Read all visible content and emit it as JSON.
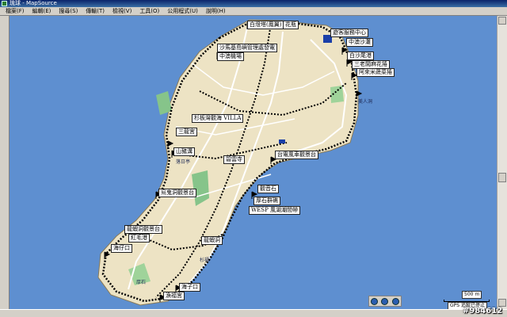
{
  "window": {
    "title": "琉球 - MapSource"
  },
  "menu": [
    {
      "label": "檔案(F)"
    },
    {
      "label": "編輯(E)"
    },
    {
      "label": "搜尋(S)"
    },
    {
      "label": "傳輸(T)"
    },
    {
      "label": "檢視(V)"
    },
    {
      "label": "工具(O)"
    },
    {
      "label": "公用程式(U)"
    },
    {
      "label": "說明(H)"
    }
  ],
  "map_labels": {
    "l1": "白燈塔(鳳翼)",
    "l2": "花瓶",
    "l3": "遊客服務中心",
    "l4": "中澳沙灘",
    "l5": "沙馬基島嶼管理處發電",
    "l6": "中澳機場",
    "l7": "白沙尾港",
    "l8": "三老闆麻花捲",
    "l9": "阿來米蔬菜捲",
    "l10": "美人洞",
    "l11": "杉板灣觀海 VILLA",
    "l12": "三龍宮",
    "l13": "山豬溝",
    "l14": "碧雲寺",
    "l15": "台電風車觀景台",
    "l16": "落日亭",
    "l17": "觀音石",
    "l18": "烏鬼洞觀景台",
    "l19": "龍蝦洞觀景台",
    "l20": "紅毛港",
    "l21": "海仔口",
    "l22": "龍蝦洞",
    "l23": "厚石群礁",
    "l24": "海子口",
    "l25": "漁福宮",
    "l26": "WESP 風湖潮間帶",
    "l27": "杉福",
    "l28": "厚石"
  },
  "scale": {
    "label": "500 m"
  },
  "status": {
    "gps": "GPS 追蹤已停止"
  },
  "watermark": "#984612",
  "colors": {
    "sea": "#5e8fd0",
    "land": "#ede3c4",
    "road": "#ffffff",
    "trail": "#000000"
  }
}
